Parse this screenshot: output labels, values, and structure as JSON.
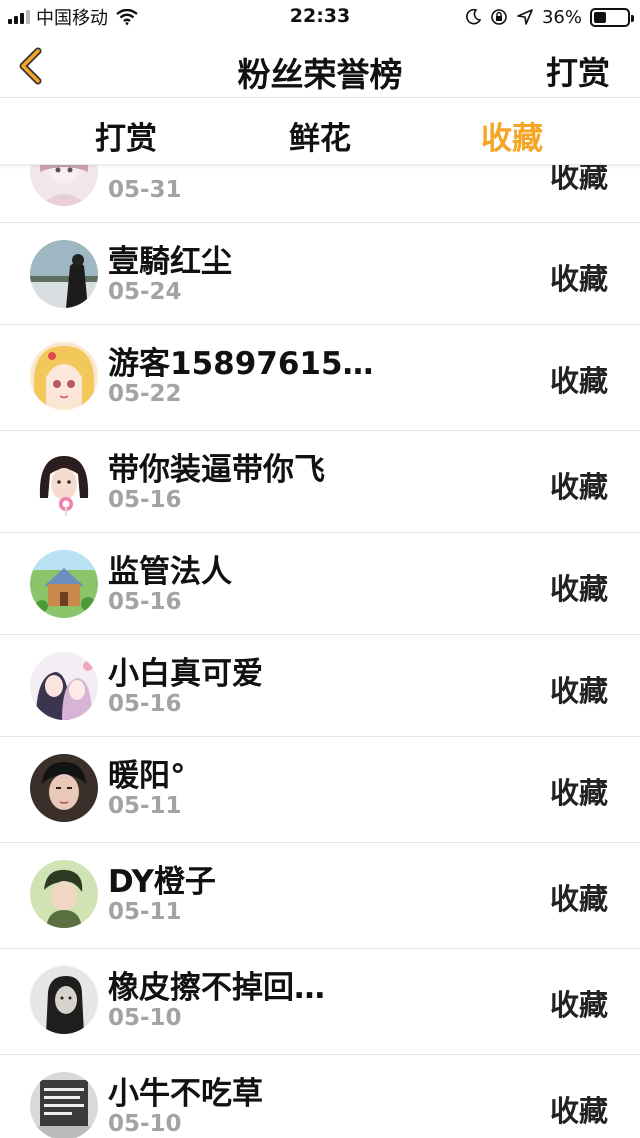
{
  "status_bar": {
    "carrier": "中国移动",
    "time": "22:33",
    "battery_percent": "36%",
    "battery_level": 0.36
  },
  "nav": {
    "title": "粉丝荣誉榜",
    "right_action": "打赏"
  },
  "tabs": [
    {
      "label": "打赏",
      "active": false
    },
    {
      "label": "鲜花",
      "active": false
    },
    {
      "label": "收藏",
      "active": true
    }
  ],
  "colors": {
    "accent": "#f5a523",
    "date_gray": "#a3a3a3"
  },
  "fans": [
    {
      "name": "",
      "date": "05-31",
      "action": "收藏",
      "avatar": "anime-girl-pink-avatar"
    },
    {
      "name": "壹騎红尘",
      "date": "05-24",
      "action": "收藏",
      "avatar": "landscape-silhouette-avatar"
    },
    {
      "name": "游客15897615…",
      "date": "05-22",
      "action": "收藏",
      "avatar": "anime-blonde-girl-avatar"
    },
    {
      "name": "带你装逼带你飞",
      "date": "05-16",
      "action": "收藏",
      "avatar": "girl-lollipop-avatar"
    },
    {
      "name": "监管法人",
      "date": "05-16",
      "action": "收藏",
      "avatar": "cartoon-house-avatar"
    },
    {
      "name": "小白真可爱",
      "date": "05-16",
      "action": "收藏",
      "avatar": "anime-couple-avatar"
    },
    {
      "name": "暖阳°",
      "date": "05-11",
      "action": "收藏",
      "avatar": "boy-portrait-avatar"
    },
    {
      "name": "DY橙子",
      "date": "05-11",
      "action": "收藏",
      "avatar": "boy-green-avatar"
    },
    {
      "name": "橡皮擦不掉回…",
      "date": "05-10",
      "action": "收藏",
      "avatar": "bw-girl-avatar"
    },
    {
      "name": "小牛不吃草",
      "date": "05-10",
      "action": "收藏",
      "avatar": "text-poster-avatar"
    }
  ]
}
